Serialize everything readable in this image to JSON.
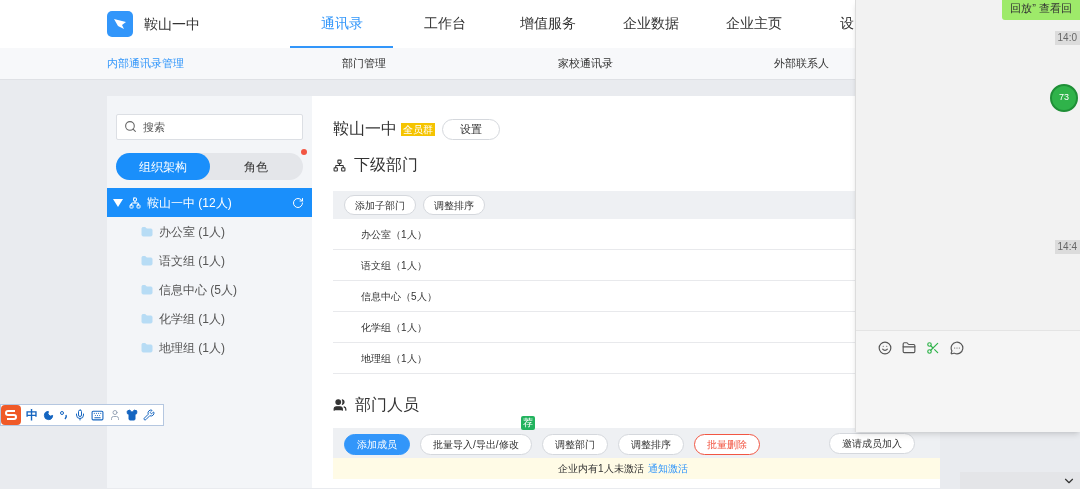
{
  "app": {
    "name": "鞍山一中"
  },
  "nav": [
    {
      "label": "通讯录",
      "selected": true
    },
    {
      "label": "工作台",
      "selected": false
    },
    {
      "label": "增值服务",
      "selected": false
    },
    {
      "label": "企业数据",
      "selected": false
    },
    {
      "label": "企业主页",
      "selected": false
    },
    {
      "label": "设",
      "selected": false
    }
  ],
  "subnav": [
    {
      "label": "内部通讯录管理",
      "selected": true
    },
    {
      "label": "部门管理",
      "selected": false
    },
    {
      "label": "家校通讯录",
      "selected": false
    },
    {
      "label": "外部联系人",
      "selected": false
    }
  ],
  "sidebar": {
    "search": {
      "placeholder": "搜索"
    },
    "tabs": [
      {
        "label": "组织架构",
        "selected": true,
        "notification": false
      },
      {
        "label": "角色",
        "selected": false,
        "notification": true
      }
    ],
    "tree": [
      {
        "label": "鞍山一中 (12人)",
        "selected": true,
        "expanded": true,
        "children": [
          {
            "label": "办公室 (1人)",
            "selected": false
          },
          {
            "label": "语文组 (1人)",
            "selected": false
          },
          {
            "label": "信息中心 (5人)",
            "selected": false
          },
          {
            "label": "化学组 (1人)",
            "selected": false
          },
          {
            "label": "地理组 (1人)",
            "selected": false
          }
        ]
      }
    ]
  },
  "main": {
    "title": "鞍山一中",
    "badge": "全员群",
    "settings_button": "设置",
    "subdepartments": {
      "heading": "下级部门",
      "buttons": [
        "添加子部门",
        "调整排序"
      ],
      "rows": [
        "办公室（1人）",
        "语文组（1人）",
        "信息中心（5人）",
        "化学组（1人）",
        "地理组（1人）"
      ]
    },
    "members": {
      "heading": "部门人员",
      "buttons": [
        {
          "label": "添加成员",
          "kind": "primary"
        },
        {
          "label": "批量导入/导出/修改",
          "kind": "default",
          "tag": "荐"
        },
        {
          "label": "调整部门",
          "kind": "default"
        },
        {
          "label": "调整排序",
          "kind": "default"
        },
        {
          "label": "批量删除",
          "kind": "danger"
        }
      ],
      "invite_button": "邀请成员加入",
      "notice": {
        "text": "企业内有1人未激活",
        "link": "通知激活"
      }
    }
  },
  "ime_toolbar": {
    "mode": "中"
  },
  "chat": {
    "messages": [
      {
        "kind": "bubble",
        "text": "回放” 查看回"
      },
      {
        "kind": "time",
        "text": "14:0"
      },
      {
        "kind": "time",
        "text": "14:4"
      }
    ],
    "badge": "73"
  }
}
